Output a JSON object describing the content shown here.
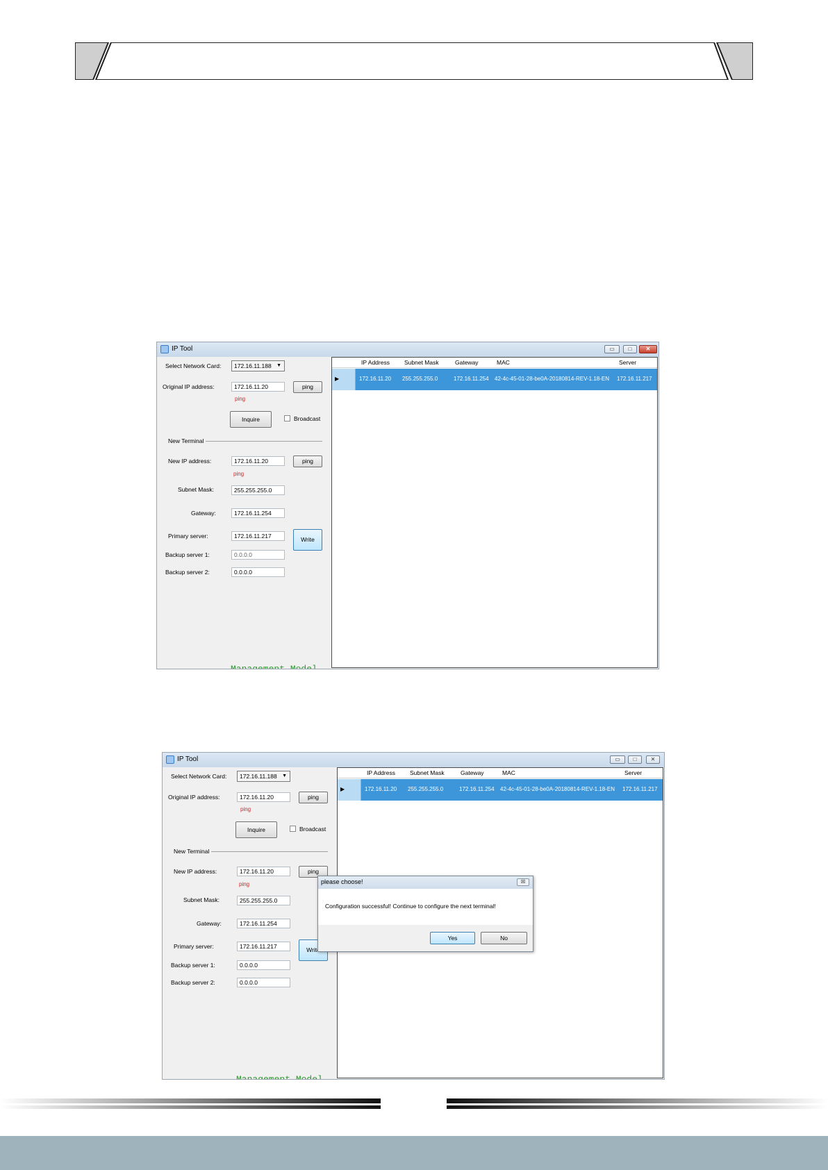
{
  "window1": {
    "title": "IP Tool",
    "controls": {
      "minimize": "▭",
      "maximize": "□",
      "close": "✕"
    },
    "labels": {
      "select_network_card": "Select Network Card:",
      "original_ip": "Original IP address:",
      "new_terminal": "New Terminal",
      "new_ip": "New IP address:",
      "subnet_mask": "Subnet Mask:",
      "gateway": "Gateway:",
      "primary_server": "Primary server:",
      "backup_server_1": "Backup server 1:",
      "backup_server_2": "Backup server 2:",
      "broadcast": "Broadcast"
    },
    "values": {
      "network_card": "172.16.11.188",
      "original_ip": "172.16.11.20",
      "new_ip": "172.16.11.20",
      "subnet_mask": "255.255.255.0",
      "gateway": "172.16.11.254",
      "primary_server": "172.16.11.217",
      "backup_server_1": "0.0.0.0",
      "backup_server_2": "0.0.0.0"
    },
    "buttons": {
      "ping": "ping",
      "inquire": "Inquire",
      "write": "Write"
    },
    "ping_status": "ping",
    "footer_label": "Management Model",
    "table": {
      "columns": [
        "IP Address",
        "Subnet Mask",
        "Gateway",
        "MAC",
        "Server"
      ],
      "row": [
        "172.16.11.20",
        "255.255.255.0",
        "172.16.11.254",
        "42-4c-45-01-28-be0A-20180814-REV-1.18-EN",
        "172.16.11.217"
      ]
    }
  },
  "window2": {
    "title": "IP Tool",
    "controls": {
      "minimize": "▭",
      "maximize": "□",
      "close": "✕"
    },
    "labels": {
      "select_network_card": "Select Network Card:",
      "original_ip": "Original IP address:",
      "new_terminal": "New Terminal",
      "new_ip": "New IP address:",
      "subnet_mask": "Subnet Mask:",
      "gateway": "Gateway:",
      "primary_server": "Primary server:",
      "backup_server_1": "Backup server 1:",
      "backup_server_2": "Backup server 2:",
      "broadcast": "Broadcast"
    },
    "values": {
      "network_card": "172.16.11.188",
      "original_ip": "172.16.11.20",
      "new_ip": "172.16.11.20",
      "subnet_mask": "255.255.255.0",
      "gateway": "172.16.11.254",
      "primary_server": "172.16.11.217",
      "backup_server_1": "0.0.0.0",
      "backup_server_2": "0.0.0.0"
    },
    "buttons": {
      "ping": "ping",
      "inquire": "Inquire",
      "write": "Write"
    },
    "ping_status": "ping",
    "footer_label": "Management Model",
    "table": {
      "columns": [
        "IP Address",
        "Subnet Mask",
        "Gateway",
        "MAC",
        "Server"
      ],
      "row": [
        "172.16.11.20",
        "255.255.255.0",
        "172.16.11.254",
        "42-4c-45-01-28-be0A-20180814-REV-1.18-EN",
        "172.16.11.217"
      ]
    },
    "dialog": {
      "title": "please choose!",
      "close": "☒",
      "message": "Configuration successful! Continue to configure the next terminal!",
      "yes": "Yes",
      "no": "No"
    }
  },
  "colors": {
    "selection_row": "#3d96d9",
    "ping_text": "#e21b1b",
    "management_text": "#2c9a2c",
    "footer_bar": "#9fb3bc"
  }
}
